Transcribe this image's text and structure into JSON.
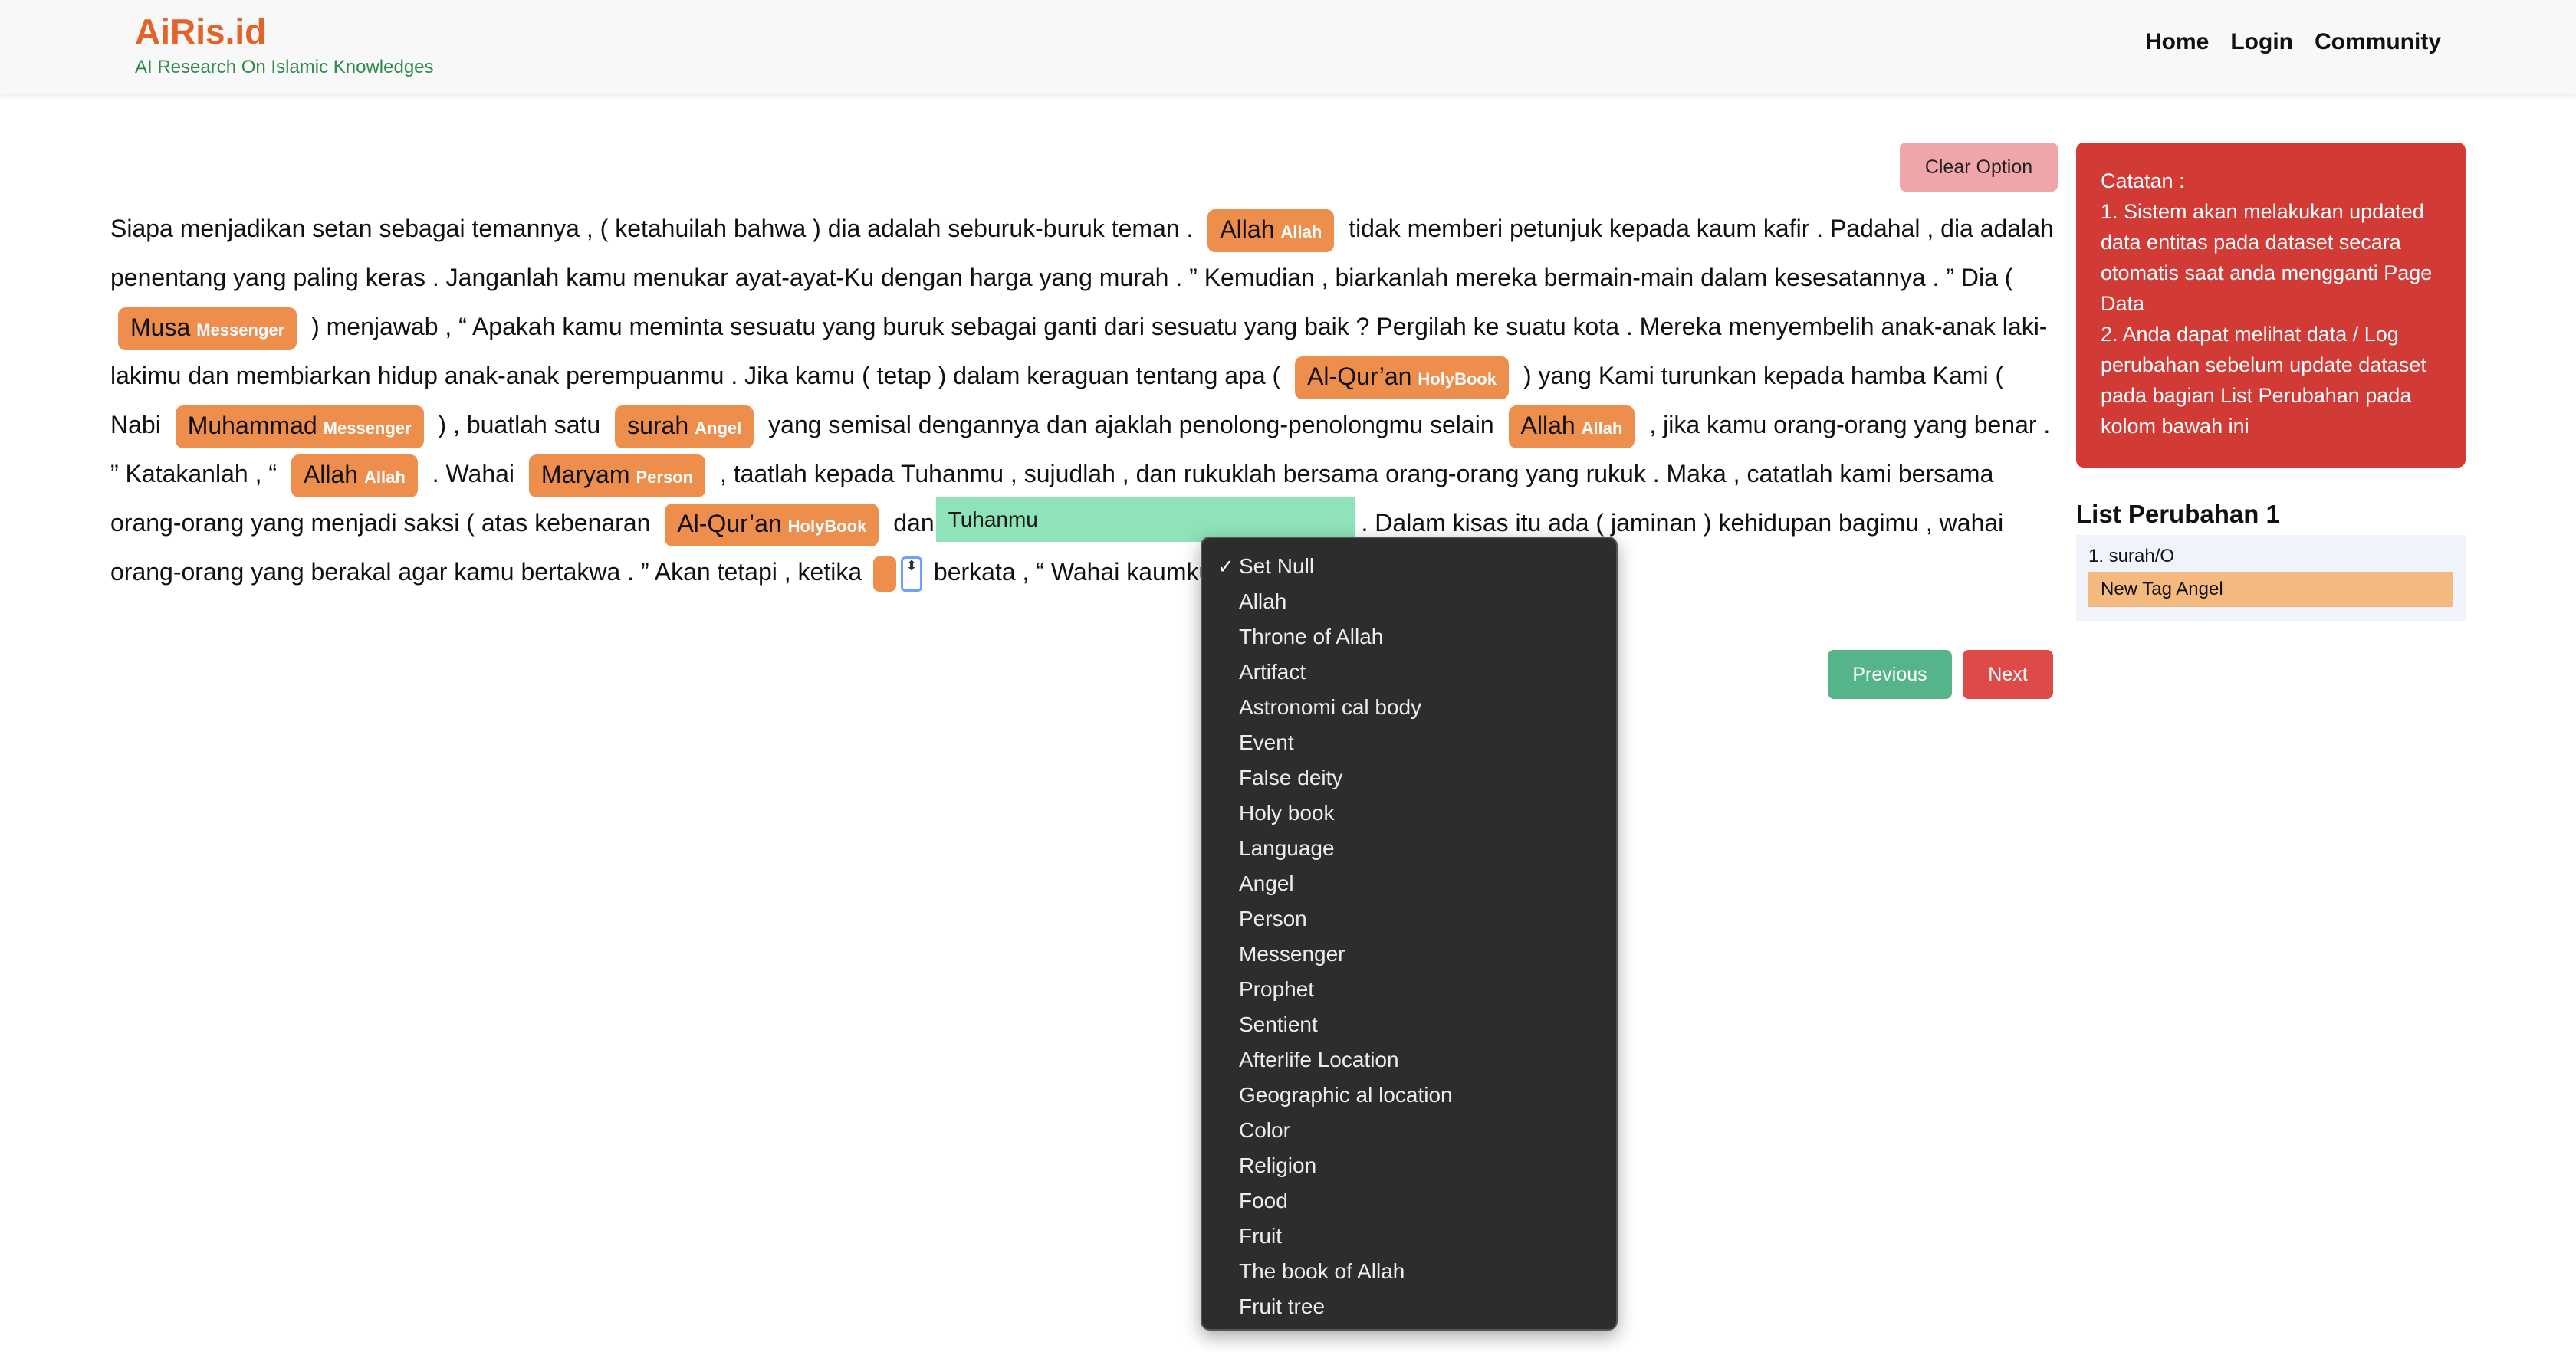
{
  "brand": {
    "title": "AiRis.id",
    "subtitle": "AI Research On Islamic Knowledges"
  },
  "nav": {
    "home": "Home",
    "login": "Login",
    "community": "Community"
  },
  "toolbar": {
    "clear_option": "Clear Option"
  },
  "text": {
    "s1": "Siapa menjadikan setan sebagai temannya , ( ketahuilah bahwa ) dia adalah seburuk-buruk teman .",
    "s2": "tidak memberi petunjuk kepada kaum kafir . Padahal , dia adalah penentang yang paling keras . Janganlah kamu menukar ayat-ayat-Ku dengan harga yang murah . ” Kemudian , biarkanlah mereka bermain-main dalam kesesatannya . ” Dia (",
    "s3": ") menjawab , “ Apakah kamu meminta sesuatu yang buruk sebagai ganti dari sesuatu yang baik ? Pergilah ke suatu kota . Mereka menyembelih anak-anak laki-lakimu dan membiarkan hidup anak-anak perempuanmu . Jika kamu ( tetap ) dalam keraguan tentang apa (",
    "s4": ") yang Kami turunkan kepada hamba Kami ( Nabi",
    "s5": ") , buatlah satu",
    "s6": "yang semisal dengannya dan ajaklah penolong-penolongmu selain",
    "s7": ", jika kamu orang-orang yang benar . ” Katakanlah , “",
    "s8": ". Wahai",
    "s9": ", taatlah kepada Tuhanmu , sujudlah , dan rukuklah bersama orang-orang yang rukuk . Maka , catatlah kami bersama orang-orang yang menjadi saksi ( atas kebenaran",
    "s10": "dan",
    "s11": ". Dalam kisas itu ada ( jaminan ) kehidupan bagimu , wahai orang-orang yang berakal agar kamu bertakwa . ” Akan tetapi , ketika",
    "s12": "berkata , “ Wahai kaumku , sesungguhnya"
  },
  "entities": [
    {
      "word": "Allah",
      "tag": "Allah"
    },
    {
      "word": "Musa",
      "tag": "Messenger"
    },
    {
      "word": "Al-Qur’an",
      "tag": "HolyBook"
    },
    {
      "word": "Muhammad",
      "tag": "Messenger"
    },
    {
      "word": "surah",
      "tag": "Angel"
    },
    {
      "word": "Allah",
      "tag": "Allah"
    },
    {
      "word": "Allah",
      "tag": "Allah"
    },
    {
      "word": "Maryam",
      "tag": "Person"
    },
    {
      "word": "Al-Qur’an",
      "tag": "HolyBook"
    }
  ],
  "editor": {
    "value": "Tuhanmu"
  },
  "dropdown": {
    "options": [
      "Set Null",
      "Allah",
      "Throne of Allah",
      "Artifact",
      "Astronomi cal body",
      "Event",
      "False deity",
      "Holy book",
      "Language",
      "Angel",
      "Person",
      "Messenger",
      "Prophet",
      "Sentient",
      "Afterlife Location",
      "Geographic al location",
      "Color",
      "Religion",
      "Food",
      "Fruit",
      "The book of Allah",
      "Fruit tree"
    ],
    "selected_check": "✓"
  },
  "pager": {
    "previous": "Previous",
    "next": "Next"
  },
  "note": {
    "title": "Catatan :",
    "line1": "1. Sistem akan melakukan updated data entitas pada dataset secara otomatis saat anda mengganti Page Data",
    "line2": "2. Anda dapat melihat data / Log perubahan sebelum update dataset pada bagian List Perubahan pada kolom bawah ini"
  },
  "log": {
    "title": "List Perubahan 1",
    "item": "1. surah/O",
    "new_tag": "New Tag Angel"
  },
  "colors": {
    "brand": "#e3642a",
    "chip": "#ed8e4d",
    "note_bg": "#d23a36",
    "prev": "#55b48a",
    "next": "#df4a48"
  }
}
